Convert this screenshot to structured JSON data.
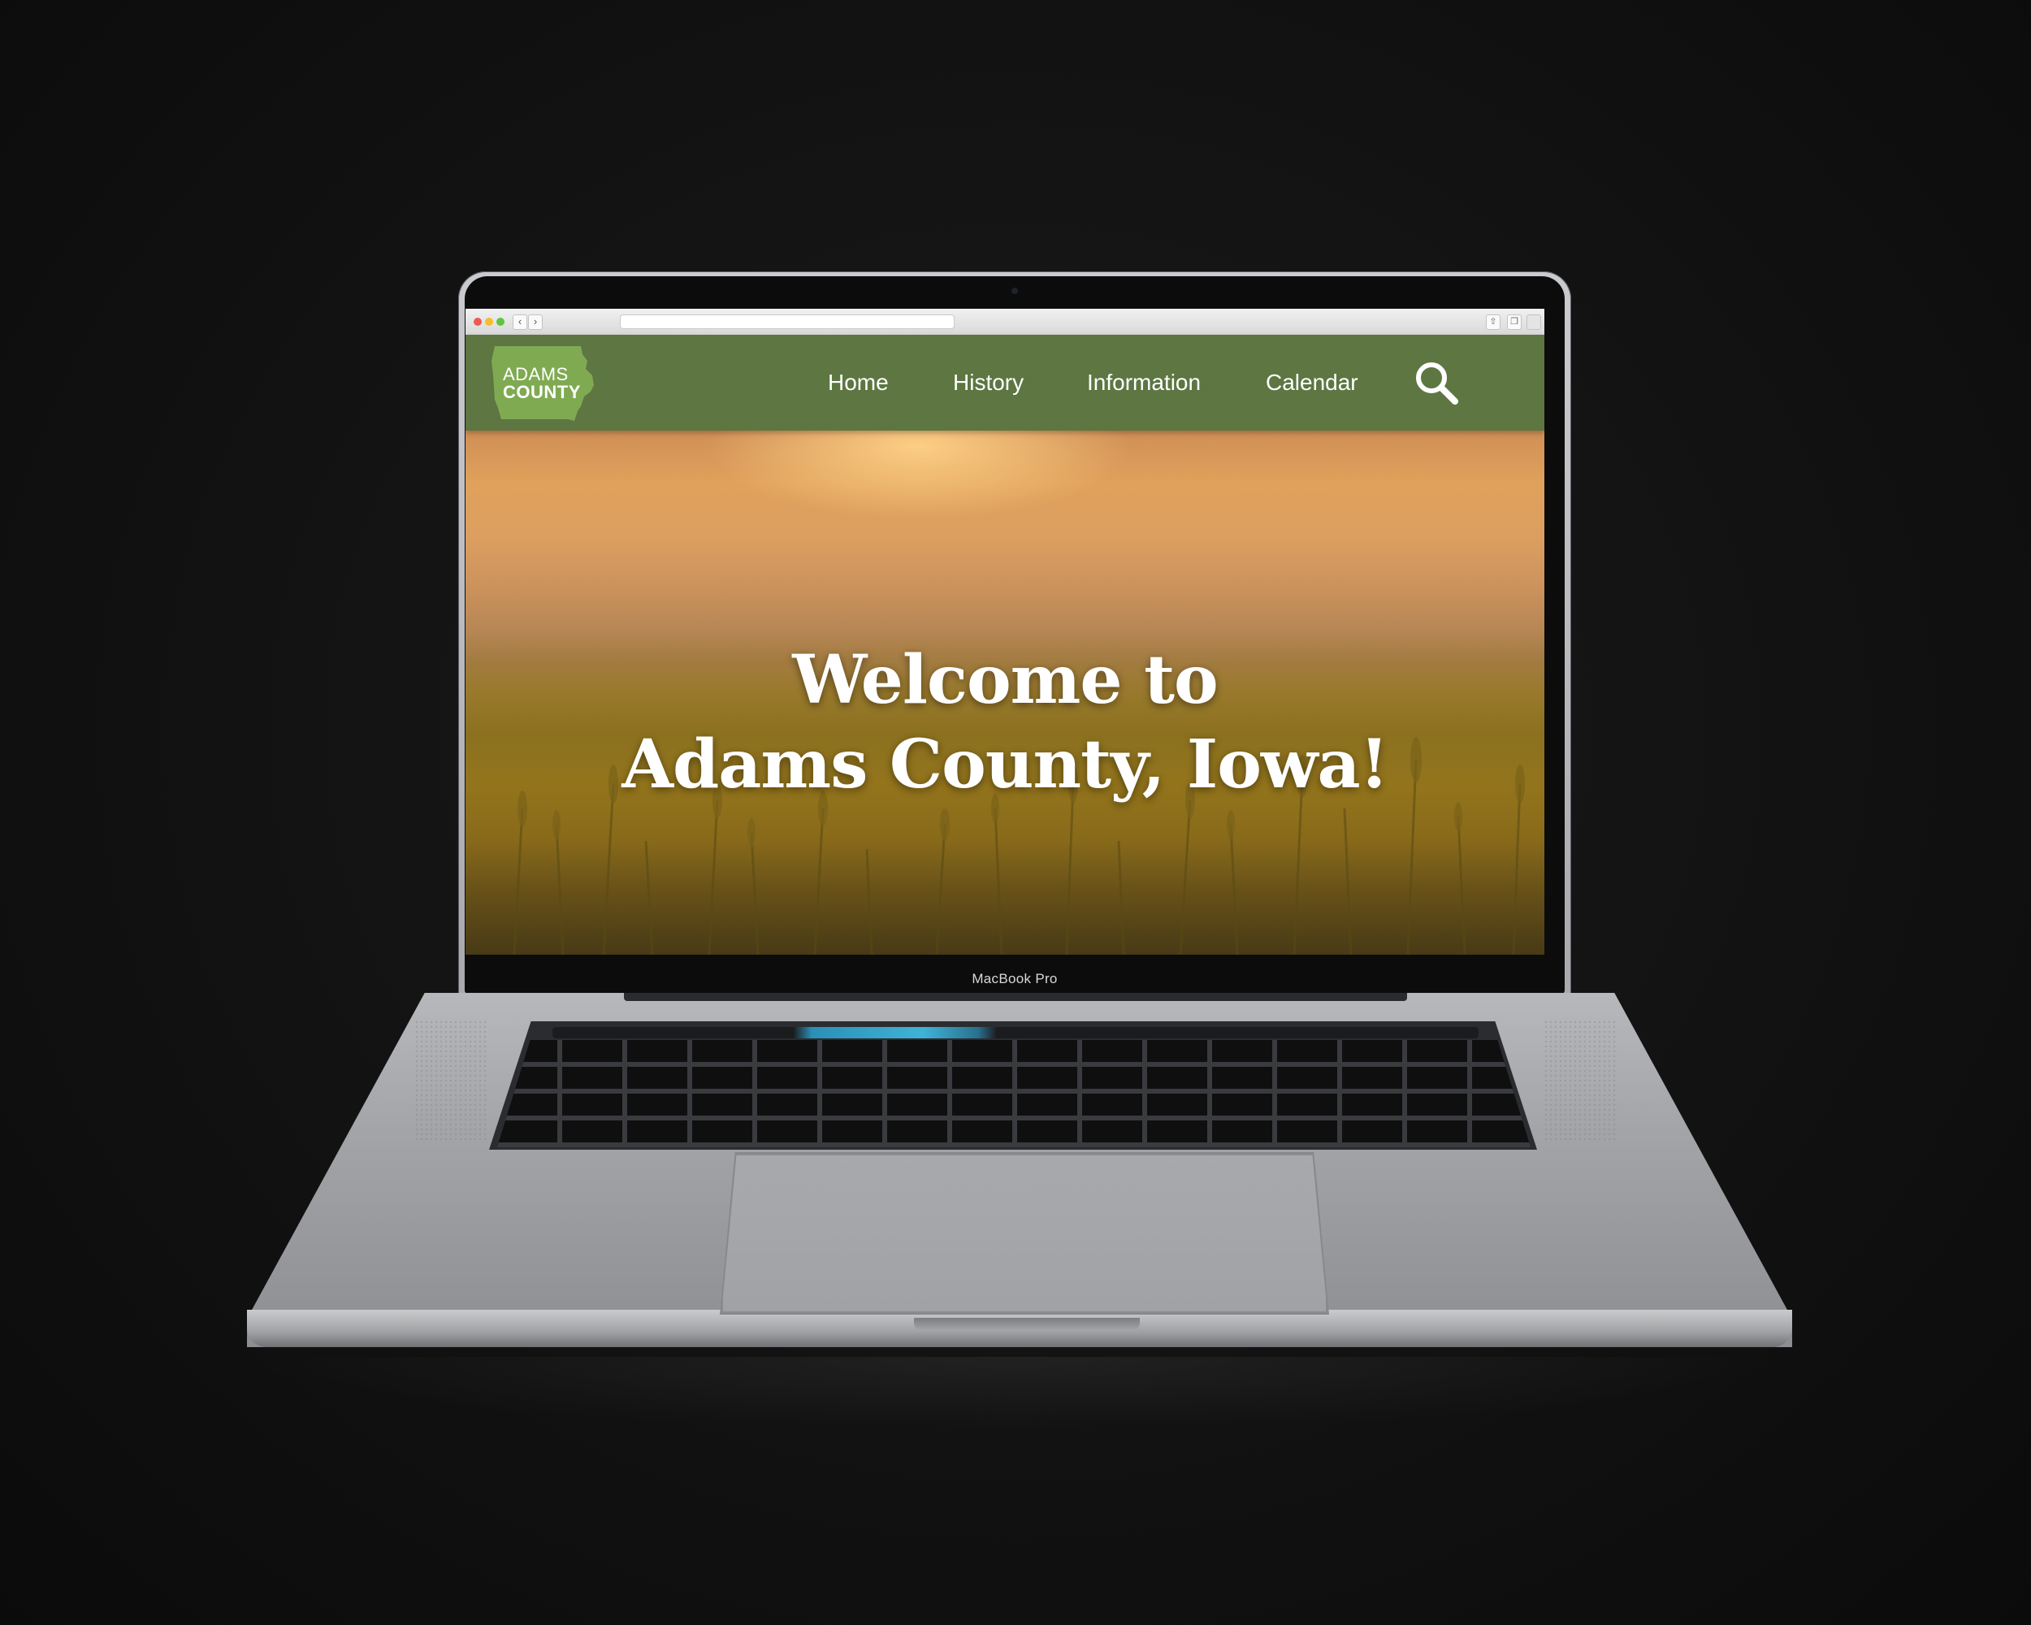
{
  "browser": {
    "back_glyph": "‹",
    "forward_glyph": "›",
    "url": "",
    "share_icon": "share-icon",
    "tabs_icon": "tabs-icon"
  },
  "site": {
    "logo": {
      "line1": "ADAMS",
      "line2": "COUNTY",
      "icon": "iowa-state-shape-icon",
      "color": "#7faa52"
    },
    "nav": {
      "home": "Home",
      "history": "History",
      "information": "Information",
      "calendar": "Calendar"
    },
    "search_icon": "magnifier-icon",
    "header_color": "#5d7642"
  },
  "hero": {
    "title_line1": "Welcome to",
    "title_line2": "Adams County, Iowa!"
  },
  "device": {
    "model_label": "MacBook Pro"
  }
}
